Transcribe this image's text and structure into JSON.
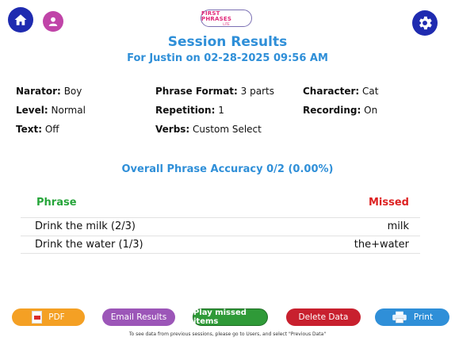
{
  "header": {
    "logo_text": "FIRST PHRASES",
    "logo_sub": "LITE",
    "title": "Session Results",
    "subtitle": "For Justin on 02-28-2025 09:56 AM"
  },
  "settings": [
    {
      "key": "Narator:",
      "value": "Boy"
    },
    {
      "key": "Phrase Format:",
      "value": "3 parts"
    },
    {
      "key": "Character:",
      "value": "Cat"
    },
    {
      "key": "Level:",
      "value": "Normal"
    },
    {
      "key": "Repetition:",
      "value": "1"
    },
    {
      "key": "Recording:",
      "value": "On"
    },
    {
      "key": "Text:",
      "value": "Off"
    },
    {
      "key": "Verbs:",
      "value": "Custom Select"
    }
  ],
  "accuracy": "Overall Phrase Accuracy 0/2 (0.00%)",
  "table": {
    "headers": {
      "phrase": "Phrase",
      "missed": "Missed"
    },
    "rows": [
      {
        "phrase": "Drink the milk (2/3)",
        "missed": "milk"
      },
      {
        "phrase": "Drink the water (1/3)",
        "missed": "the+water"
      }
    ]
  },
  "buttons": {
    "pdf": "PDF",
    "email": "Email Results",
    "play": "Play missed items",
    "delete": "Delete Data",
    "print": "Print"
  },
  "footer": "To see data from previous sessions, please go to Users, and select \"Previous Data\"",
  "icons": {
    "home": "home-icon",
    "user": "user-icon",
    "settings": "gear-icon",
    "pdf": "pdf-icon",
    "print": "printer-icon"
  },
  "colors": {
    "accent_blue": "#2f8fd8",
    "nav_blue": "#1f2bb0",
    "phrase_green": "#26a53a",
    "missed_red": "#dd2222"
  }
}
